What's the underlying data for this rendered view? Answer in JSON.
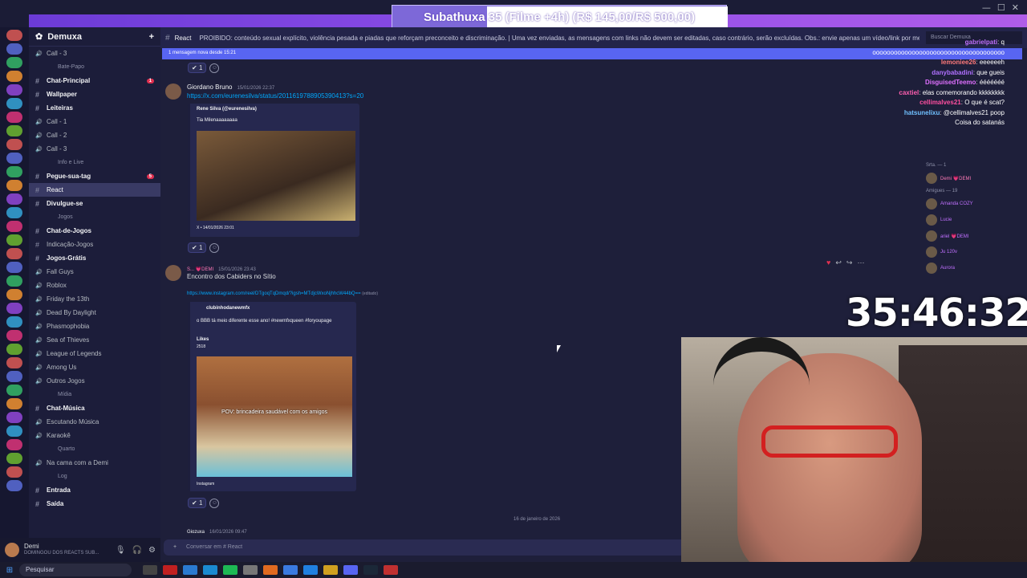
{
  "subathon": {
    "text": "Subathuxa 35 (Filme +4h) (R$ 145,00/R$ 500,00)"
  },
  "guild": {
    "name": "Demuxa"
  },
  "channels": [
    {
      "type": "voice",
      "label": "Call - 3"
    },
    {
      "type": "category",
      "label": "Bate-Papo"
    },
    {
      "type": "text",
      "label": "Chat-Principal",
      "bold": true,
      "badge": "1"
    },
    {
      "type": "text",
      "label": "Wallpaper",
      "bold": true
    },
    {
      "type": "text",
      "label": "Leiteiras",
      "bold": true
    },
    {
      "type": "voice",
      "label": "Call - 1"
    },
    {
      "type": "voice",
      "label": "Call - 2"
    },
    {
      "type": "voice",
      "label": "Call - 3"
    },
    {
      "type": "category",
      "label": "Info e Live"
    },
    {
      "type": "text",
      "label": "Pegue-sua-tag",
      "bold": true,
      "badge": "5"
    },
    {
      "type": "text",
      "label": "React",
      "selected": true
    },
    {
      "type": "text",
      "label": "Divulgue-se",
      "bold": true
    },
    {
      "type": "category",
      "label": "Jogos"
    },
    {
      "type": "text",
      "label": "Chat-de-Jogos",
      "bold": true
    },
    {
      "type": "text",
      "label": "Indicação-Jogos"
    },
    {
      "type": "text",
      "label": "Jogos-Grátis",
      "bold": true
    },
    {
      "type": "voice",
      "label": "Fall Guys"
    },
    {
      "type": "voice",
      "label": "Roblox"
    },
    {
      "type": "voice",
      "label": "Friday the 13th"
    },
    {
      "type": "voice",
      "label": "Dead By Daylight"
    },
    {
      "type": "voice",
      "label": "Phasmophobia"
    },
    {
      "type": "voice",
      "label": "Sea of Thieves"
    },
    {
      "type": "voice",
      "label": "League of Legends"
    },
    {
      "type": "voice",
      "label": "Among Us"
    },
    {
      "type": "voice",
      "label": "Outros Jogos"
    },
    {
      "type": "category",
      "label": "Mídia"
    },
    {
      "type": "text",
      "label": "Chat-Música",
      "bold": true
    },
    {
      "type": "voice",
      "label": "Escutando Música"
    },
    {
      "type": "voice",
      "label": "Karaokê"
    },
    {
      "type": "category",
      "label": "Quarto"
    },
    {
      "type": "voice",
      "label": "Na cama com a Demi"
    },
    {
      "type": "category",
      "label": "Log"
    },
    {
      "type": "text",
      "label": "Entrada",
      "bold": true
    },
    {
      "type": "text",
      "label": "Saída",
      "bold": true
    }
  ],
  "user": {
    "name": "Demi",
    "status": "DOMINGOU DOS REACTS SUB..."
  },
  "header": {
    "channel": "React",
    "topic": "PROIBIDO: conteúdo sexual explícito, violência pesada e piadas que reforçam preconceito e discriminação. | Uma vez enviadas, as mensagens com links não devem ser editadas, caso contrário, serão excluídas. Obs.: envie apenas um vídeo/link por mensagem.",
    "search_placeholder": "Buscar Demuxa"
  },
  "new_messages_bar": "1 mensagem nova desde 15:21",
  "messages": [
    {
      "author": "Giordano Bruno",
      "timestamp": "15/01/2026 22:37",
      "link": "https://x.com/eurenesilva/status/2011619788905390413?s=20",
      "embed_author": "Rene Silva (@eurenesilva)",
      "embed_text": "Tia Milenaaaaaaaa",
      "embed_footer": "X • 14/01/2026 23:01",
      "reaction_count": "1"
    },
    {
      "author": "S... 💗DEMI",
      "timestamp": "15/01/2026 23:43",
      "text": "Encontro dos Cabiders no Sítio",
      "link": "https://www.instagram.com/reel/DTgoqTqDmqd/?igsh=MTdjcWxoNjhhcW44bQ==",
      "link_suffix": "(editado)",
      "embed_author": "clubinhodanewmfx",
      "embed_text": "o BBB tá meio diferente esse ano! #newmfxqueen #foryoupage",
      "embed_likes_label": "Likes",
      "embed_likes": "2518",
      "embed_caption": "POV: brincadeira saudável com os amigos",
      "embed_footer": "Instagram",
      "reaction_count": "1"
    }
  ],
  "date_divider": "16 de janeiro de 2026",
  "next_author": "Giozuxa",
  "next_timestamp": "16/01/2026 09:47",
  "composer_placeholder": "Conversar em # React",
  "top_reaction_count": "1",
  "stream_chat": [
    {
      "user": "gabrielpati",
      "text": "q",
      "color": "#c070ff"
    },
    {
      "user": "",
      "text": "ooooooooooooooooooooooooooooooooooooo",
      "color": "#ffffff"
    },
    {
      "user": "lemoniee26",
      "text": "eeeeeeh",
      "color": "#ff7a7a"
    },
    {
      "user": "danybabadini",
      "text": "que gueis",
      "color": "#b070ff"
    },
    {
      "user": "DisguisedTeemo",
      "text": "ééééééé",
      "color": "#e070ff"
    },
    {
      "user": "caxtiel",
      "text": "elas comemorando kkkkkkkk",
      "color": "#ff5fb0"
    },
    {
      "user": "cellimalves21",
      "text": "O que é scat?",
      "color": "#ff4fa0"
    },
    {
      "user": "hatsunelixu",
      "text": "@cellimalves21 poop",
      "color": "#70c0ff"
    },
    {
      "user": "",
      "text": "Coisa do satanás",
      "color": "#ffffff"
    }
  ],
  "members": {
    "section1": "Srta. — 1",
    "section2": "Amigues — 19",
    "items": [
      "Demi 💗DEMI",
      "Amanda COZY",
      "Lucie",
      "ariel 💗DEMI",
      "Ju 120v",
      "Aurora"
    ]
  },
  "timer": "35:46:32",
  "taskbar": {
    "search": "Pesquisar"
  },
  "colors": {
    "accent": "#5865f2",
    "link": "#00a8fc",
    "bg": "#1e1f3a"
  }
}
